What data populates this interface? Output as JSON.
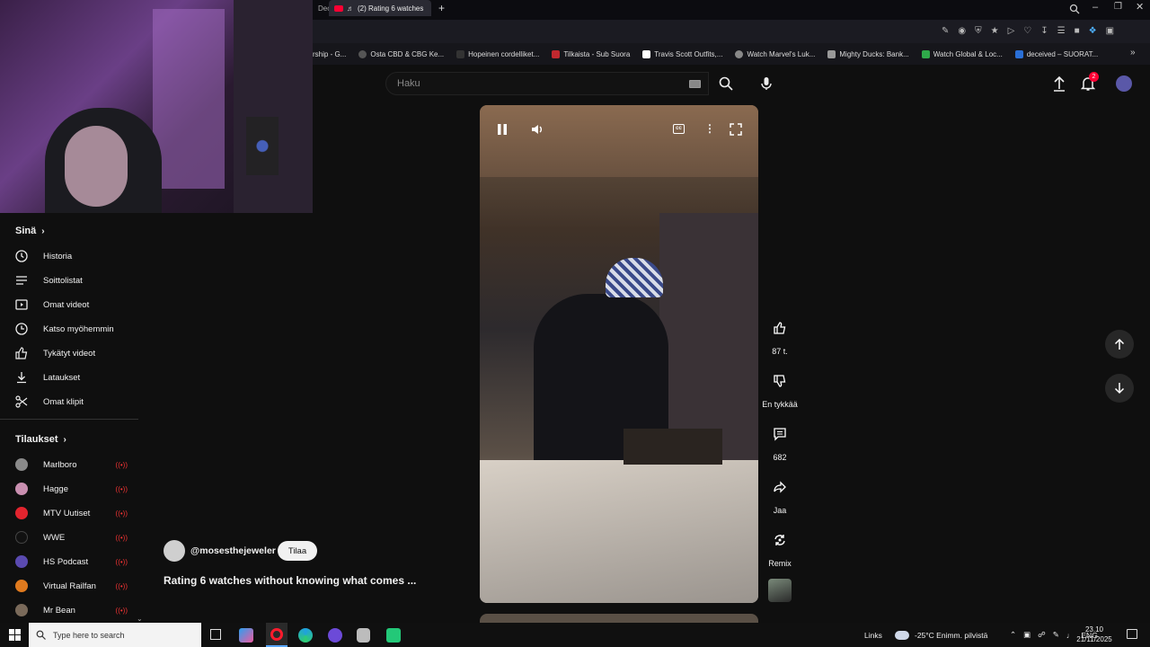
{
  "browser": {
    "tab_prev_label": "Dec",
    "active_tab_title": "(2) Rating 6 watches",
    "bookmarks": [
      "rship - G...",
      "Osta CBD & CBG Ke...",
      "Hopeinen cordelliket...",
      "Tilkaista - Sub Suora",
      "Travis Scott Outfits,...",
      "Watch Marvel's Luk...",
      "Mighty Ducks: Bank...",
      "Watch Global & Loc...",
      "deceived – SUORAT..."
    ]
  },
  "header": {
    "search_placeholder": "Haku",
    "notification_count": "2"
  },
  "sidebar": {
    "you_heading": "Sinä",
    "you_items": [
      {
        "label": "Historia",
        "icon": "history-icon"
      },
      {
        "label": "Soittolistat",
        "icon": "playlists-icon"
      },
      {
        "label": "Omat videot",
        "icon": "your-videos-icon"
      },
      {
        "label": "Katso myöhemmin",
        "icon": "watch-later-icon"
      },
      {
        "label": "Tykätyt videot",
        "icon": "liked-icon"
      },
      {
        "label": "Lataukset",
        "icon": "downloads-icon"
      },
      {
        "label": "Omat klipit",
        "icon": "clips-icon"
      }
    ],
    "subs_heading": "Tilaukset",
    "subscriptions": [
      {
        "name": "Marlboro",
        "color": "#8a8a8a"
      },
      {
        "name": "Hagge",
        "color": "#c98fb0"
      },
      {
        "name": "MTV Uutiset",
        "color": "#e2242e"
      },
      {
        "name": "WWE",
        "color": "#111111"
      },
      {
        "name": "HS Podcast",
        "color": "#5a4ab0"
      },
      {
        "name": "Virtual Railfan",
        "color": "#e07a1e"
      },
      {
        "name": "Mr Bean",
        "color": "#7a6a5a"
      }
    ]
  },
  "short": {
    "channel": "@mosesthejeweler",
    "subscribe_label": "Tilaa",
    "title": "Rating 6 watches without knowing what comes ...",
    "likes": "87 t.",
    "dislike_label": "En tykkää",
    "comments": "682",
    "share_label": "Jaa",
    "remix_label": "Remix"
  },
  "taskbar": {
    "search_placeholder": "Type here to search",
    "links_label": "Links",
    "weather": "-25°C  Enimm. pilvistä",
    "language": "ENG",
    "time": "23.10",
    "date": "21/11/2025"
  },
  "colors": {
    "accent_red": "#ff0033",
    "background": "#0f0f0f"
  }
}
